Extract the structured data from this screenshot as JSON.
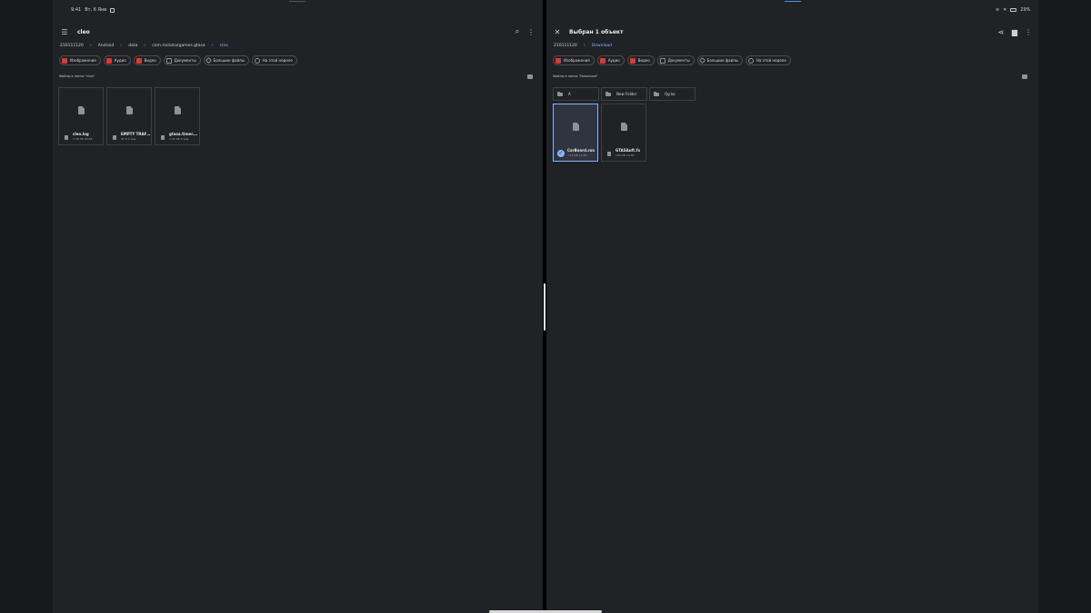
{
  "status_bar": {
    "time": "9:41",
    "date": "Вт, 6 Янв",
    "battery": "29%"
  },
  "left_pane": {
    "title": "cleo",
    "breadcrumbs": [
      "210111120",
      "Android",
      "data",
      "com.rockstargames.gtasa",
      "cleo"
    ],
    "chips": [
      "Изображения",
      "Аудио",
      "Видео",
      "Документы",
      "Большие файлы",
      "На этой неделе"
    ],
    "section_label": "Файлы в папке \"cleo\"",
    "files": [
      {
        "name": "cleo.log",
        "meta": "5,39 КБ 09:03"
      },
      {
        "name": "EMPTY TRAFF...",
        "meta": "41 Б 4 янв."
      },
      {
        "name": "gtasa.timer.fl...",
        "meta": "1,43 КБ 4 янв."
      }
    ]
  },
  "right_pane": {
    "title": "Выбран 1 объект",
    "breadcrumbs": [
      "210111120",
      "Download"
    ],
    "chips": [
      "Изображения",
      "Аудио",
      "Видео",
      "Документы",
      "Большие файлы",
      "На этой неделе"
    ],
    "section_label": "Файлы в папке \"Download\"",
    "folders": [
      "A",
      "New Folder",
      "Og ko"
    ],
    "files": [
      {
        "name": "CarBoard.csa",
        "meta": "7,19 КБ 10:46",
        "selected": true
      },
      {
        "name": "GTASAuft.fx",
        "meta": "190 КБ 10:46",
        "selected": false
      }
    ]
  }
}
